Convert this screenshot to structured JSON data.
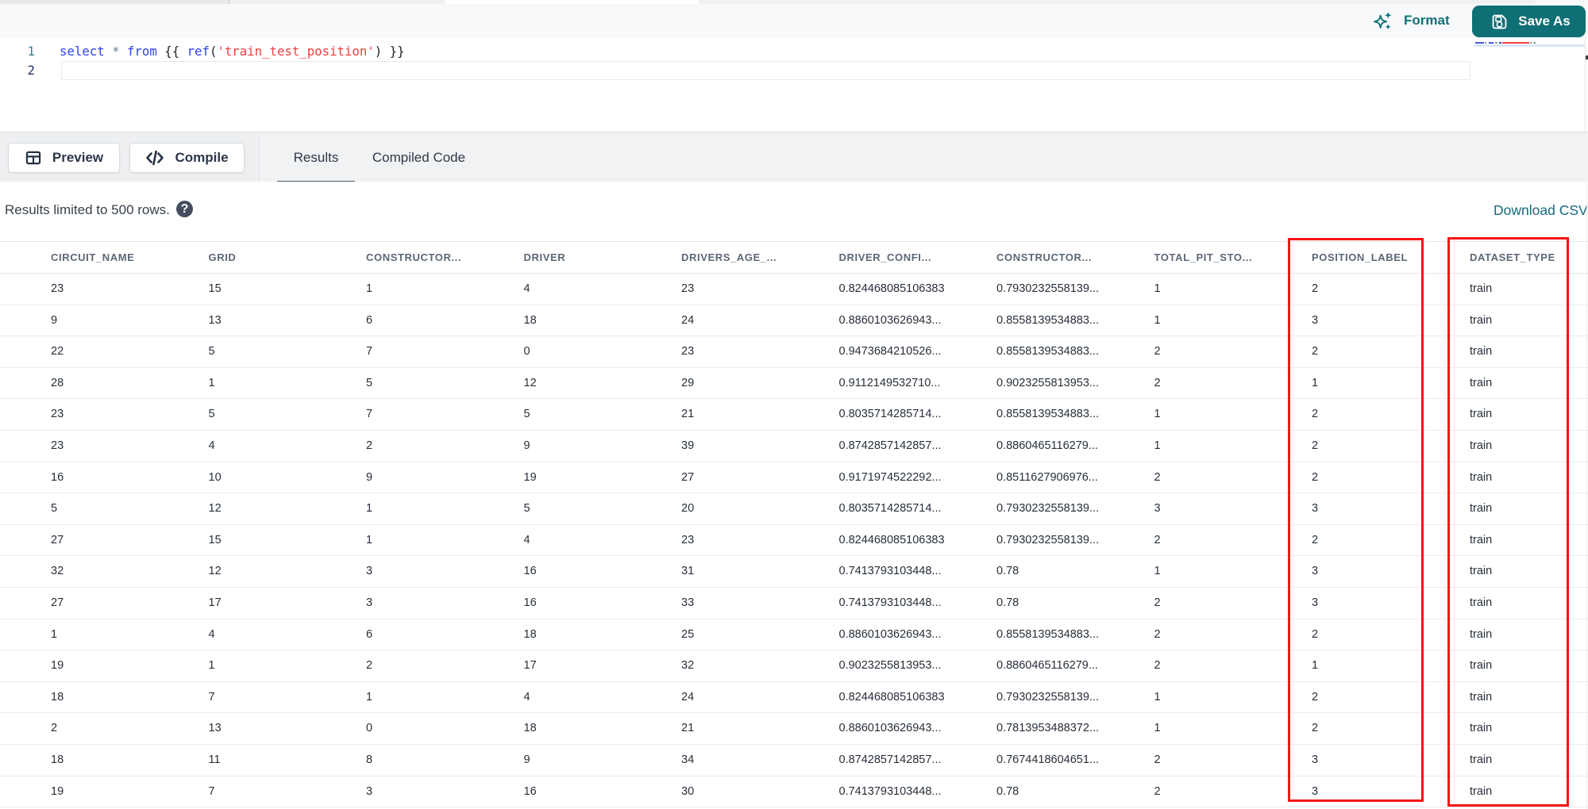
{
  "colors": {
    "accent_teal": "#0e6f75",
    "link_teal": "#16697e",
    "annotation_red": "#f81414",
    "keyword_blue": "#2e41f0",
    "string_red": "#f23c3f"
  },
  "editor": {
    "line_numbers": [
      "1",
      "2"
    ],
    "code_tokens": [
      {
        "text": "select",
        "type": "kw"
      },
      {
        "text": " ",
        "type": "pl"
      },
      {
        "text": "*",
        "type": "op"
      },
      {
        "text": " ",
        "type": "pl"
      },
      {
        "text": "from",
        "type": "kw"
      },
      {
        "text": " ",
        "type": "pl"
      },
      {
        "text": "{{",
        "type": "pl"
      },
      {
        "text": " ",
        "type": "pl"
      },
      {
        "text": "ref",
        "type": "kw"
      },
      {
        "text": "(",
        "type": "pl"
      },
      {
        "text": "'train_test_position'",
        "type": "str"
      },
      {
        "text": ")",
        "type": "pl"
      },
      {
        "text": " ",
        "type": "pl"
      },
      {
        "text": "}}",
        "type": "pl"
      }
    ],
    "minimap_dashes": [
      {
        "x": 2,
        "w": 10.5,
        "color": "#4853e6"
      },
      {
        "x": 13.5,
        "w": 2,
        "color": "#9298a3"
      },
      {
        "x": 19,
        "w": 6.3,
        "color": "#4853e6"
      },
      {
        "x": 27,
        "w": 2.6,
        "color": "#9298a3"
      },
      {
        "x": 32.3,
        "w": 3,
        "color": "#3a43b8"
      },
      {
        "x": 35.6,
        "w": 34.4,
        "color": "#ee4444"
      },
      {
        "x": 71.3,
        "w": 1.4,
        "color": "#9298a3"
      },
      {
        "x": 74.6,
        "w": 3,
        "color": "#9298a3"
      }
    ]
  },
  "header_actions": {
    "format_label": "Format",
    "save_as_label": "Save As"
  },
  "toolbar": {
    "preview_label": "Preview",
    "compile_label": "Compile",
    "tabs": [
      {
        "label": "Results",
        "active": true
      },
      {
        "label": "Compiled Code",
        "active": false
      }
    ]
  },
  "results": {
    "limit_note": "Results limited to 500 rows.",
    "help_glyph": "?",
    "download_csv_label": "Download CSV",
    "columns": [
      "CIRCUIT_NAME",
      "GRID",
      "CONSTRUCTOR...",
      "DRIVER",
      "DRIVERS_AGE_...",
      "DRIVER_CONFI...",
      "CONSTRUCTOR...",
      "TOTAL_PIT_STO...",
      "POSITION_LABEL",
      "DATASET_TYPE"
    ],
    "rows": [
      [
        "23",
        "15",
        "1",
        "4",
        "23",
        "0.824468085106383",
        "0.7930232558139...",
        "1",
        "2",
        "train"
      ],
      [
        "9",
        "13",
        "6",
        "18",
        "24",
        "0.8860103626943...",
        "0.8558139534883...",
        "1",
        "3",
        "train"
      ],
      [
        "22",
        "5",
        "7",
        "0",
        "23",
        "0.9473684210526...",
        "0.8558139534883...",
        "2",
        "2",
        "train"
      ],
      [
        "28",
        "1",
        "5",
        "12",
        "29",
        "0.9112149532710...",
        "0.9023255813953...",
        "2",
        "1",
        "train"
      ],
      [
        "23",
        "5",
        "7",
        "5",
        "21",
        "0.8035714285714...",
        "0.8558139534883...",
        "1",
        "2",
        "train"
      ],
      [
        "23",
        "4",
        "2",
        "9",
        "39",
        "0.8742857142857...",
        "0.8860465116279...",
        "1",
        "2",
        "train"
      ],
      [
        "16",
        "10",
        "9",
        "19",
        "27",
        "0.9171974522292...",
        "0.8511627906976...",
        "2",
        "2",
        "train"
      ],
      [
        "5",
        "12",
        "1",
        "5",
        "20",
        "0.8035714285714...",
        "0.7930232558139...",
        "3",
        "3",
        "train"
      ],
      [
        "27",
        "15",
        "1",
        "4",
        "23",
        "0.824468085106383",
        "0.7930232558139...",
        "2",
        "2",
        "train"
      ],
      [
        "32",
        "12",
        "3",
        "16",
        "31",
        "0.7413793103448...",
        "0.78",
        "1",
        "3",
        "train"
      ],
      [
        "27",
        "17",
        "3",
        "16",
        "33",
        "0.7413793103448...",
        "0.78",
        "2",
        "3",
        "train"
      ],
      [
        "1",
        "4",
        "6",
        "18",
        "25",
        "0.8860103626943...",
        "0.8558139534883...",
        "2",
        "2",
        "train"
      ],
      [
        "19",
        "1",
        "2",
        "17",
        "32",
        "0.9023255813953...",
        "0.8860465116279...",
        "2",
        "1",
        "train"
      ],
      [
        "18",
        "7",
        "1",
        "4",
        "24",
        "0.824468085106383",
        "0.7930232558139...",
        "1",
        "2",
        "train"
      ],
      [
        "2",
        "13",
        "0",
        "18",
        "21",
        "0.8860103626943...",
        "0.7813953488372...",
        "1",
        "2",
        "train"
      ],
      [
        "18",
        "11",
        "8",
        "9",
        "34",
        "0.8742857142857...",
        "0.7674418604651...",
        "2",
        "3",
        "train"
      ],
      [
        "19",
        "7",
        "3",
        "16",
        "30",
        "0.7413793103448...",
        "0.78",
        "2",
        "3",
        "train"
      ]
    ]
  },
  "annotations": {
    "highlight_columns": [
      "POSITION_LABEL",
      "DATASET_TYPE"
    ]
  }
}
